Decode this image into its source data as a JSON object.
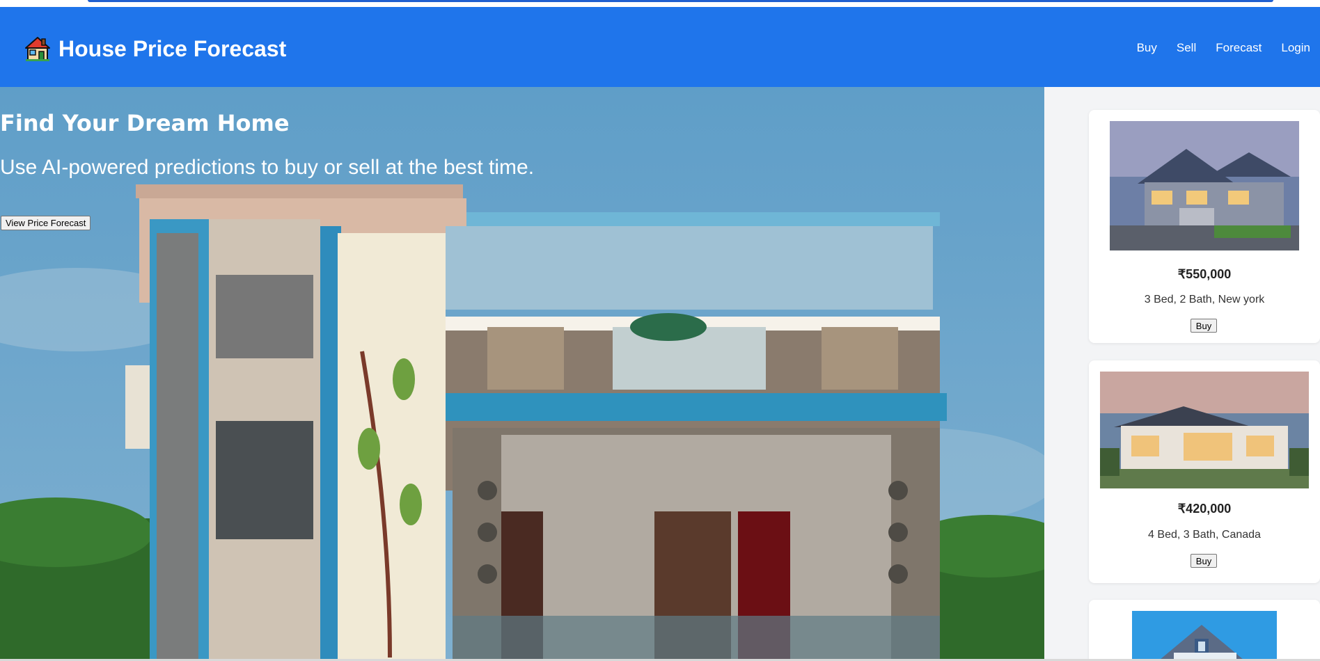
{
  "brand": {
    "title": "House Price Forecast",
    "icon": "house-icon"
  },
  "nav": {
    "links": [
      "Buy",
      "Sell",
      "Forecast",
      "Login"
    ]
  },
  "hero": {
    "heading": "Find Your Dream Home",
    "subheading": "Use AI-powered predictions to buy or sell at the best time.",
    "button_label": "View Price Forecast"
  },
  "listings": [
    {
      "price": "₹550,000",
      "details": "3 Bed, 2 Bath, New york",
      "button_label": "Buy"
    },
    {
      "price": "₹420,000",
      "details": "4 Bed, 3 Bath, Canada",
      "button_label": "Buy"
    },
    {
      "price": "",
      "details": "",
      "button_label": ""
    }
  ],
  "colors": {
    "navbar": "#1f75eb",
    "sidebar_bg": "#f3f4f6",
    "sky": "#5f9fc6"
  }
}
